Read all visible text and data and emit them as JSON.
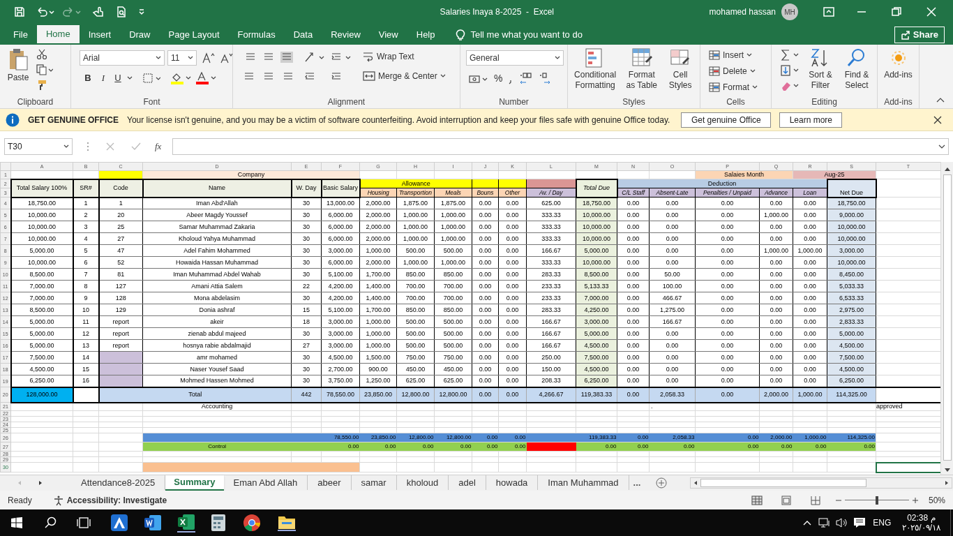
{
  "window": {
    "title": "Salaries Inaya 8-2025  -  Excel",
    "user": "mohamed hassan",
    "initials": "MH"
  },
  "menu_tabs": [
    {
      "label": "File",
      "selected": false
    },
    {
      "label": "Home",
      "selected": true
    },
    {
      "label": "Insert",
      "selected": false
    },
    {
      "label": "Draw",
      "selected": false
    },
    {
      "label": "Page Layout",
      "selected": false
    },
    {
      "label": "Formulas",
      "selected": false
    },
    {
      "label": "Data",
      "selected": false
    },
    {
      "label": "Review",
      "selected": false
    },
    {
      "label": "View",
      "selected": false
    },
    {
      "label": "Help",
      "selected": false
    }
  ],
  "tell_me": "Tell me what you want to do",
  "share": "Share",
  "ribbon": {
    "groups": [
      {
        "kind": "clipboard",
        "label": "Clipboard",
        "paste": "Paste"
      },
      {
        "kind": "font",
        "label": "Font",
        "font_name": "Arial",
        "font_size": "11",
        "bold": "B",
        "italic": "I",
        "underline": "U"
      },
      {
        "kind": "alignment",
        "label": "Alignment",
        "wrap": "Wrap Text",
        "merge": "Merge & Center"
      },
      {
        "kind": "number",
        "label": "Number",
        "format": "General",
        "percent": "%"
      },
      {
        "kind": "styles",
        "label": "Styles",
        "buttons": [
          "Conditional Formatting",
          "Format as Table",
          "Cell Styles"
        ]
      },
      {
        "kind": "cells",
        "label": "Cells",
        "buttons": [
          "Insert",
          "Delete",
          "Format"
        ]
      },
      {
        "kind": "editing",
        "label": "Editing",
        "buttons": [
          "Sort & Filter",
          "Find & Select"
        ]
      },
      {
        "kind": "addins",
        "label": "Add-ins",
        "buttons": [
          "Add-ins"
        ]
      }
    ]
  },
  "message_bar": {
    "title": "GET GENUINE OFFICE",
    "text": "Your license isn't genuine, and you may be a victim of software counterfeiting. Avoid interruption and keep your files safe with genuine Office today.",
    "buttons": [
      "Get genuine Office",
      "Learn more"
    ]
  },
  "formula_bar": {
    "name_box": "T30",
    "function_label": "fx"
  },
  "sheet": {
    "column_letters": [
      "A",
      "B",
      "C",
      "D",
      "E",
      "F",
      "G",
      "H",
      "I",
      "J",
      "K",
      "L",
      "M",
      "N",
      "O",
      "P",
      "Q",
      "R",
      "S",
      "T"
    ],
    "row_numbers": [
      "1",
      "2",
      "3",
      "4",
      "5",
      "6",
      "7",
      "8",
      "9",
      "10",
      "11",
      "12",
      "13",
      "14",
      "15",
      "16",
      "17",
      "18",
      "19",
      "20",
      "21",
      "22",
      "23",
      "24",
      "25",
      "26",
      "27",
      "28",
      "29",
      "30"
    ],
    "title_row": {
      "company": "Company",
      "month_label": "Salaies Month",
      "month": "Aug-25"
    },
    "header": {
      "allowance": "Allowance",
      "deduction": "Deduction",
      "columns": [
        "Total Salary 100%",
        "SR#",
        "Code",
        "Name",
        "W. Day",
        "Basic Salary",
        "Housing",
        "Transportion",
        "Meals",
        "Bouns",
        "Other",
        "Av. / Day",
        "Total Due",
        "C/L Staff",
        "Absent-Late",
        "Penalties / Unpaid",
        "Advance",
        "Loan",
        "Net Due"
      ]
    },
    "employees": [
      {
        "total_salary": "18,750.00",
        "sr": "1",
        "code": "1",
        "name": "Iman Abd'Allah",
        "w_day": "30",
        "basic_salary": "13,000.00",
        "housing": "2,000.00",
        "transportion": "1,875.00",
        "meals": "1,875.00",
        "bouns": "0.00",
        "other": "0.00",
        "av_day": "625.00",
        "total_due": "18,750.00",
        "cl_staff": "0.00",
        "absent_late": "0.00",
        "penalties_unpaid": "0.00",
        "advance": "0.00",
        "loan": "0.00",
        "net_due": "18,750.00"
      },
      {
        "total_salary": "10,000.00",
        "sr": "2",
        "code": "20",
        "name": "Abeer Magdy Youssef",
        "w_day": "30",
        "basic_salary": "6,000.00",
        "housing": "2,000.00",
        "transportion": "1,000.00",
        "meals": "1,000.00",
        "bouns": "0.00",
        "other": "0.00",
        "av_day": "333.33",
        "total_due": "10,000.00",
        "cl_staff": "0.00",
        "absent_late": "0.00",
        "penalties_unpaid": "0.00",
        "advance": "1,000.00",
        "loan": "0.00",
        "net_due": "9,000.00"
      },
      {
        "total_salary": "10,000.00",
        "sr": "3",
        "code": "25",
        "name": "Samar Muhammad Zakaria",
        "w_day": "30",
        "basic_salary": "6,000.00",
        "housing": "2,000.00",
        "transportion": "1,000.00",
        "meals": "1,000.00",
        "bouns": "0.00",
        "other": "0.00",
        "av_day": "333.33",
        "total_due": "10,000.00",
        "cl_staff": "0.00",
        "absent_late": "0.00",
        "penalties_unpaid": "0.00",
        "advance": "0.00",
        "loan": "0.00",
        "net_due": "10,000.00"
      },
      {
        "total_salary": "10,000.00",
        "sr": "4",
        "code": "27",
        "name": "Kholoud Yahya Muhammad",
        "w_day": "30",
        "basic_salary": "6,000.00",
        "housing": "2,000.00",
        "transportion": "1,000.00",
        "meals": "1,000.00",
        "bouns": "0.00",
        "other": "0.00",
        "av_day": "333.33",
        "total_due": "10,000.00",
        "cl_staff": "0.00",
        "absent_late": "0.00",
        "penalties_unpaid": "0.00",
        "advance": "0.00",
        "loan": "0.00",
        "net_due": "10,000.00"
      },
      {
        "total_salary": "5,000.00",
        "sr": "5",
        "code": "47",
        "name": "Adel Fahim Mohammed",
        "w_day": "30",
        "basic_salary": "3,000.00",
        "housing": "1,000.00",
        "transportion": "500.00",
        "meals": "500.00",
        "bouns": "0.00",
        "other": "0.00",
        "av_day": "166.67",
        "total_due": "5,000.00",
        "cl_staff": "0.00",
        "absent_late": "0.00",
        "penalties_unpaid": "0.00",
        "advance": "1,000.00",
        "loan": "1,000.00",
        "net_due": "3,000.00"
      },
      {
        "total_salary": "10,000.00",
        "sr": "6",
        "code": "52",
        "name": "Howaida Hassan Muhammad",
        "w_day": "30",
        "basic_salary": "6,000.00",
        "housing": "2,000.00",
        "transportion": "1,000.00",
        "meals": "1,000.00",
        "bouns": "0.00",
        "other": "0.00",
        "av_day": "333.33",
        "total_due": "10,000.00",
        "cl_staff": "0.00",
        "absent_late": "0.00",
        "penalties_unpaid": "0.00",
        "advance": "0.00",
        "loan": "0.00",
        "net_due": "10,000.00"
      },
      {
        "total_salary": "8,500.00",
        "sr": "7",
        "code": "81",
        "name": "Iman Muhammad Abdel Wahab",
        "w_day": "30",
        "basic_salary": "5,100.00",
        "housing": "1,700.00",
        "transportion": "850.00",
        "meals": "850.00",
        "bouns": "0.00",
        "other": "0.00",
        "av_day": "283.33",
        "total_due": "8,500.00",
        "cl_staff": "0.00",
        "absent_late": "50.00",
        "penalties_unpaid": "0.00",
        "advance": "0.00",
        "loan": "0.00",
        "net_due": "8,450.00"
      },
      {
        "total_salary": "7,000.00",
        "sr": "8",
        "code": "127",
        "name": "Amani Attia Salem",
        "w_day": "22",
        "basic_salary": "4,200.00",
        "housing": "1,400.00",
        "transportion": "700.00",
        "meals": "700.00",
        "bouns": "0.00",
        "other": "0.00",
        "av_day": "233.33",
        "total_due": "5,133.33",
        "cl_staff": "0.00",
        "absent_late": "100.00",
        "penalties_unpaid": "0.00",
        "advance": "0.00",
        "loan": "0.00",
        "net_due": "5,033.33"
      },
      {
        "total_salary": "7,000.00",
        "sr": "9",
        "code": "128",
        "name": "Mona abdelasim",
        "w_day": "30",
        "basic_salary": "4,200.00",
        "housing": "1,400.00",
        "transportion": "700.00",
        "meals": "700.00",
        "bouns": "0.00",
        "other": "0.00",
        "av_day": "233.33",
        "total_due": "7,000.00",
        "cl_staff": "0.00",
        "absent_late": "466.67",
        "penalties_unpaid": "0.00",
        "advance": "0.00",
        "loan": "0.00",
        "net_due": "6,533.33"
      },
      {
        "total_salary": "8,500.00",
        "sr": "10",
        "code": "129",
        "name": "Donia ashraf",
        "w_day": "15",
        "basic_salary": "5,100.00",
        "housing": "1,700.00",
        "transportion": "850.00",
        "meals": "850.00",
        "bouns": "0.00",
        "other": "0.00",
        "av_day": "283.33",
        "total_due": "4,250.00",
        "cl_staff": "0.00",
        "absent_late": "1,275.00",
        "penalties_unpaid": "0.00",
        "advance": "0.00",
        "loan": "0.00",
        "net_due": "2,975.00"
      },
      {
        "total_salary": "5,000.00",
        "sr": "11",
        "code": "report",
        "name": "akeir",
        "w_day": "18",
        "basic_salary": "3,000.00",
        "housing": "1,000.00",
        "transportion": "500.00",
        "meals": "500.00",
        "bouns": "0.00",
        "other": "0.00",
        "av_day": "166.67",
        "total_due": "3,000.00",
        "cl_staff": "0.00",
        "absent_late": "166.67",
        "penalties_unpaid": "0.00",
        "advance": "0.00",
        "loan": "0.00",
        "net_due": "2,833.33"
      },
      {
        "total_salary": "5,000.00",
        "sr": "12",
        "code": "report",
        "name": "zienab abdul majeed",
        "w_day": "30",
        "basic_salary": "3,000.00",
        "housing": "1,000.00",
        "transportion": "500.00",
        "meals": "500.00",
        "bouns": "0.00",
        "other": "0.00",
        "av_day": "166.67",
        "total_due": "5,000.00",
        "cl_staff": "0.00",
        "absent_late": "0.00",
        "penalties_unpaid": "0.00",
        "advance": "0.00",
        "loan": "0.00",
        "net_due": "5,000.00"
      },
      {
        "total_salary": "5,000.00",
        "sr": "13",
        "code": "report",
        "name": "hosnya rabie abdalmajid",
        "w_day": "27",
        "basic_salary": "3,000.00",
        "housing": "1,000.00",
        "transportion": "500.00",
        "meals": "500.00",
        "bouns": "0.00",
        "other": "0.00",
        "av_day": "166.67",
        "total_due": "4,500.00",
        "cl_staff": "0.00",
        "absent_late": "0.00",
        "penalties_unpaid": "0.00",
        "advance": "0.00",
        "loan": "0.00",
        "net_due": "4,500.00"
      },
      {
        "total_salary": "7,500.00",
        "sr": "14",
        "name": "amr mohamed",
        "w_day": "30",
        "basic_salary": "4,500.00",
        "housing": "1,500.00",
        "transportion": "750.00",
        "meals": "750.00",
        "bouns": "0.00",
        "other": "0.00",
        "av_day": "250.00",
        "total_due": "7,500.00",
        "cl_staff": "0.00",
        "absent_late": "0.00",
        "penalties_unpaid": "0.00",
        "advance": "0.00",
        "loan": "0.00",
        "net_due": "7,500.00"
      },
      {
        "total_salary": "4,500.00",
        "sr": "15",
        "name": "Naser Yousef Saad",
        "w_day": "30",
        "basic_salary": "2,700.00",
        "housing": "900.00",
        "transportion": "450.00",
        "meals": "450.00",
        "bouns": "0.00",
        "other": "0.00",
        "av_day": "150.00",
        "total_due": "4,500.00",
        "cl_staff": "0.00",
        "absent_late": "0.00",
        "penalties_unpaid": "0.00",
        "advance": "0.00",
        "loan": "0.00",
        "net_due": "4,500.00"
      },
      {
        "total_salary": "6,250.00",
        "sr": "16",
        "name": "Mohmed Hassen Mohmed",
        "w_day": "30",
        "basic_salary": "3,750.00",
        "housing": "1,250.00",
        "transportion": "625.00",
        "meals": "625.00",
        "bouns": "0.00",
        "other": "0.00",
        "av_day": "208.33",
        "total_due": "6,250.00",
        "cl_staff": "0.00",
        "absent_late": "0.00",
        "penalties_unpaid": "0.00",
        "advance": "0.00",
        "loan": "0.00",
        "net_due": "6,250.00"
      }
    ],
    "total_row": {
      "total_salary": "128,000.00",
      "label": "Total",
      "w_day": "442",
      "basic_salary": "78,550.00",
      "housing": "23,850.00",
      "transportion": "12,800.00",
      "meals": "12,800.00",
      "bouns": "0.00",
      "other": "0.00",
      "av_day": "4,266.67",
      "total_due": "119,383.33",
      "cl_staff": "0.00",
      "absent_late": "2,058.33",
      "penalties_unpaid": "0.00",
      "advance": "2,000.00",
      "loan": "1,000.00",
      "net_due": "114,325.00"
    },
    "notes": {
      "accounting": "Accounting",
      "mark": ".",
      "approved": "approved"
    },
    "check_totals": {
      "basic_salary": "78,550.00",
      "housing": "23,850.00",
      "transportion": "12,800.00",
      "meals": "12,800.00",
      "bouns": "0.00",
      "other": "0.00",
      "total_due": "119,383.33",
      "cl_staff": "0.00",
      "absent_late": "2,058.33",
      "penalties_unpaid": "0.00",
      "advance": "2,000.00",
      "loan": "1,000.00",
      "net_due": "114,325.00"
    },
    "control": {
      "label": "Control",
      "av_day_flag": true,
      "basic_salary": "0.00",
      "housing": "0.00",
      "transportion": "0.00",
      "meals": "0.00",
      "bouns": "0.00",
      "other": "0.00",
      "total_due": "0.00",
      "cl_staff": "0.00",
      "absent_late": "0.00",
      "penalties_unpaid": "0.00",
      "advance": "0.00",
      "loan": "0.00",
      "net_due": "0.00"
    },
    "row_30": {
      "highlight": true,
      "cursor": true
    }
  },
  "sheet_tabs": [
    {
      "label": "Attendance8-2025",
      "selected": false
    },
    {
      "label": "Summary",
      "selected": true
    },
    {
      "label": "Eman Abd Allah",
      "selected": false
    },
    {
      "label": "abeer",
      "selected": false
    },
    {
      "label": "samar",
      "selected": false
    },
    {
      "label": "kholoud",
      "selected": false
    },
    {
      "label": "adel",
      "selected": false
    },
    {
      "label": "howada",
      "selected": false
    },
    {
      "label": "Iman Muhammad",
      "selected": false
    }
  ],
  "more_tabs": "...",
  "status_bar": {
    "ready": "Ready",
    "accessibility": "Accessibility: Investigate",
    "zoom": "50%",
    "zoom_slider": {
      "level": 0.5
    }
  },
  "taskbar": {
    "language": "ENG",
    "time": "02:38",
    "period": "م",
    "date": "٢٠٢٥/٠٩/١٨"
  }
}
